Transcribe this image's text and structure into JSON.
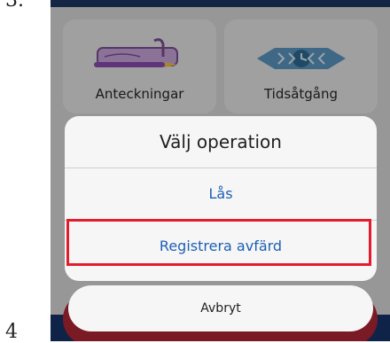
{
  "step_numbers": {
    "top": "3.",
    "bottom": "4"
  },
  "tiles": [
    {
      "label": "Anteckningar",
      "icon": "pencil-case-icon"
    },
    {
      "label": "Tidsåtgång",
      "icon": "clock-ribbon-icon"
    }
  ],
  "sheet": {
    "title": "Välj operation",
    "options": [
      "Lås",
      "Registrera avfärd"
    ]
  },
  "cancel_label": "Avbryt",
  "colors": {
    "accent_link": "#1d5fb5",
    "highlight": "#e31b2c",
    "screen_header": "#1c3560"
  }
}
